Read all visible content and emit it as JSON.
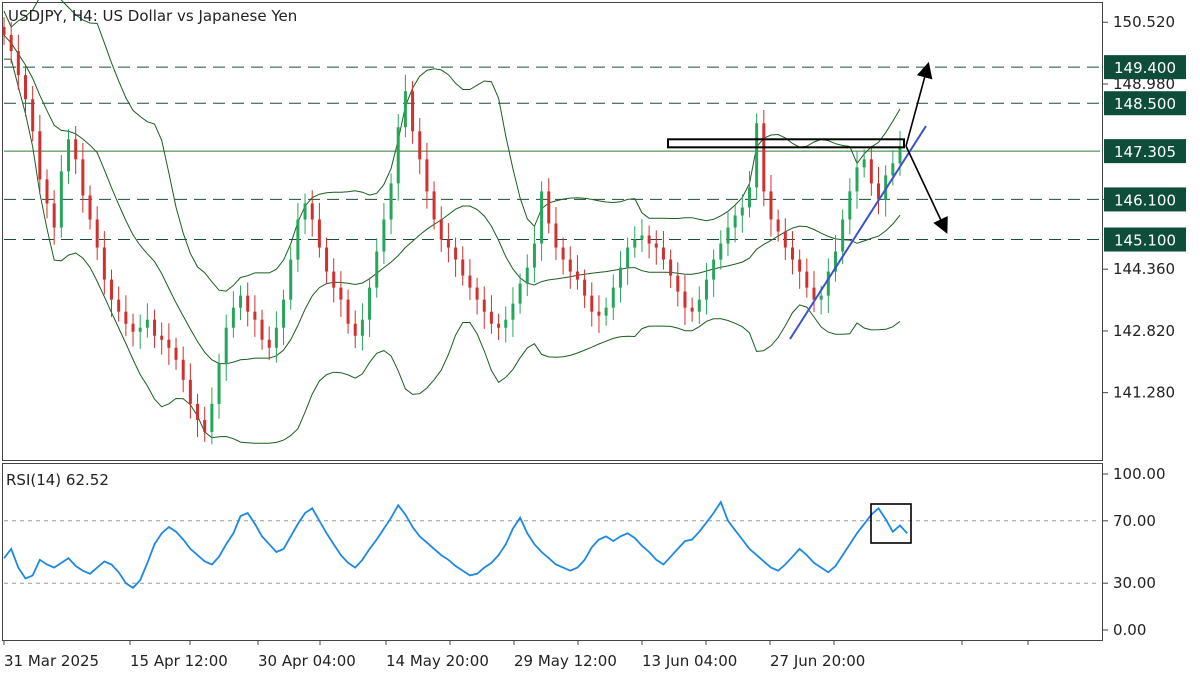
{
  "chart_data": [
    {
      "type": "candlestick",
      "title": "USDJPY, H4:  US Dollar vs Japanese Yen",
      "ylim": [
        139.6,
        151.0
      ],
      "y_ticks": [
        "150.520",
        "148.980",
        "146.100",
        "144.360",
        "142.820",
        "141.280"
      ],
      "x_ticks": [
        "31 Mar 2025",
        "15 Apr 12:00",
        "30 Apr 04:00",
        "14 May 20:00",
        "29 May 12:00",
        "13 Jun 04:00",
        "27 Jun 20:00"
      ],
      "levels": [
        {
          "value": 149.4,
          "label": "149.400",
          "style": "dashed"
        },
        {
          "value": 148.5,
          "label": "148.500",
          "style": "dashed"
        },
        {
          "value": 147.305,
          "label": "147.305",
          "style": "solid"
        },
        {
          "value": 146.1,
          "label": "146.100",
          "style": "dashed"
        },
        {
          "value": 145.1,
          "label": "145.100",
          "style": "dashed"
        }
      ],
      "resistance_zone": [
        147.4,
        147.6
      ],
      "series": [
        {
          "name": "close",
          "values": [
            150.2,
            149.8,
            149.2,
            148.6,
            147.8,
            146.6,
            146.0,
            145.4,
            146.8,
            147.6,
            147.1,
            146.2,
            145.6,
            144.9,
            144.1,
            143.6,
            143.3,
            143.0,
            142.8,
            142.9,
            143.1,
            142.7,
            142.6,
            142.4,
            142.1,
            141.6,
            141.0,
            140.6,
            140.3,
            141.0,
            142.0,
            142.9,
            143.4,
            143.7,
            143.3,
            143.1,
            142.6,
            142.4,
            142.9,
            143.6,
            144.6,
            145.6,
            146.0,
            145.6,
            144.9,
            144.3,
            143.9,
            143.6,
            143.0,
            142.7,
            143.1,
            143.9,
            144.8,
            145.6,
            146.5,
            147.9,
            148.8,
            147.8,
            147.1,
            146.3,
            145.6,
            145.1,
            144.9,
            144.6,
            144.2,
            143.9,
            143.6,
            143.3,
            143.0,
            142.9,
            143.1,
            143.5,
            144.0,
            144.4,
            145.0,
            146.3,
            145.5,
            144.9,
            144.6,
            144.3,
            144.1,
            143.7,
            143.3,
            143.2,
            143.4,
            143.9,
            144.4,
            144.9,
            145.1,
            145.2,
            145.0,
            144.9,
            144.6,
            144.2,
            143.8,
            143.4,
            143.3,
            143.6,
            144.1,
            144.6,
            145.0,
            145.4,
            145.7,
            145.9,
            146.4,
            148.0,
            146.3,
            145.6,
            145.3,
            144.9,
            144.6,
            144.3,
            143.9,
            143.6,
            143.7,
            144.3,
            144.8,
            145.6,
            146.3,
            146.9,
            147.1,
            146.5,
            146.1,
            146.7,
            147.0,
            147.4
          ],
          "color": "#000000"
        },
        {
          "name": "RSI(14) 62.52",
          "values": [
            46,
            52,
            40,
            33,
            35,
            45,
            42,
            40,
            43,
            46,
            41,
            38,
            36,
            40,
            44,
            42,
            37,
            30,
            27,
            32,
            43,
            55,
            62,
            66,
            63,
            58,
            52,
            48,
            44,
            42,
            47,
            55,
            62,
            73,
            75,
            68,
            60,
            55,
            50,
            52,
            60,
            68,
            75,
            78,
            70,
            62,
            55,
            48,
            43,
            40,
            45,
            52,
            58,
            65,
            72,
            80,
            74,
            66,
            60,
            56,
            52,
            48,
            45,
            41,
            38,
            35,
            36,
            40,
            43,
            48,
            55,
            65,
            72,
            62,
            55,
            50,
            46,
            42,
            40,
            38,
            40,
            45,
            53,
            58,
            60,
            57,
            60,
            62,
            59,
            54,
            50,
            45,
            42,
            47,
            52,
            57,
            58,
            63,
            69,
            75,
            82,
            70,
            64,
            58,
            52,
            48,
            44,
            40,
            38,
            42,
            47,
            52,
            48,
            43,
            40,
            37,
            41,
            48,
            55,
            62,
            68,
            74,
            78,
            71,
            63,
            67,
            62
          ],
          "color": "#1e88e5"
        }
      ]
    },
    {
      "type": "line",
      "title": "RSI(14) 62.52",
      "ylim": [
        0,
        100
      ],
      "y_ticks": [
        "100.00",
        "70.00",
        "30.00",
        "0.00"
      ],
      "levels": [
        70,
        30
      ]
    }
  ],
  "colors": {
    "up": "#26a65b",
    "down": "#d32f2f",
    "band": "#1b5e20",
    "level_label_bg": "#0d4d3a",
    "trendline": "#3f51c8",
    "rsi": "#1e88e5"
  }
}
